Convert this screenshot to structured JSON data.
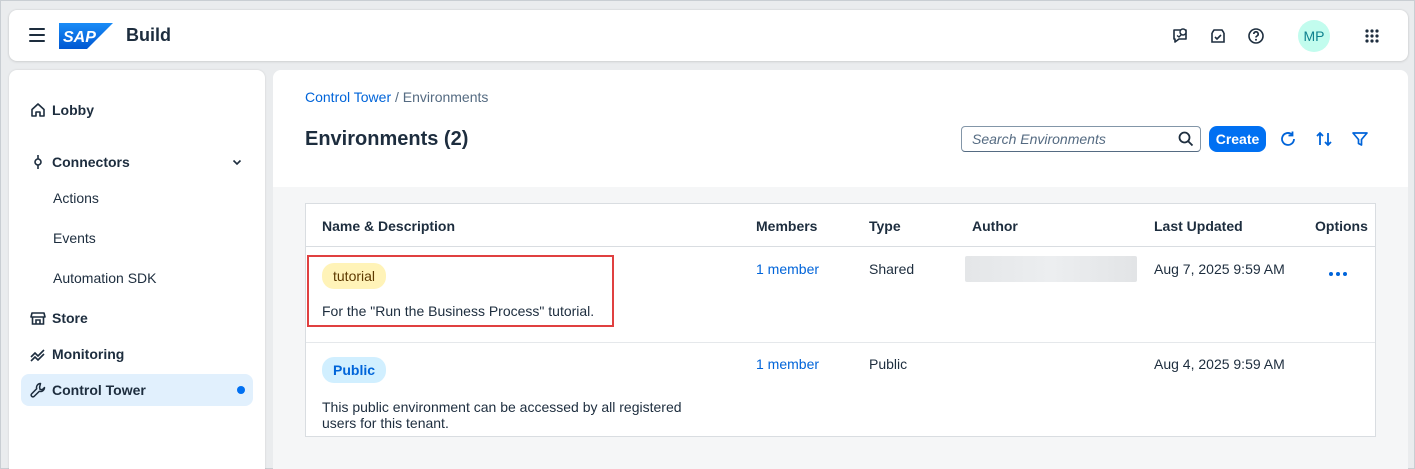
{
  "shell": {
    "logo_text": "SAP",
    "product": "Build",
    "avatar_initials": "MP",
    "icons": [
      "assistant-icon",
      "downloads-icon",
      "help-icon",
      "app-grid-icon"
    ],
    "colors": {
      "accent": "#0070f2",
      "logo": "#0070f2",
      "avatar_bg": "#c2fcee"
    }
  },
  "sidebar": {
    "lobby": "Lobby",
    "connectors": "Connectors",
    "actions": "Actions",
    "events": "Events",
    "automation_sdk": "Automation SDK",
    "store": "Store",
    "monitoring": "Monitoring",
    "control_tower": "Control Tower"
  },
  "page": {
    "breadcrumb_link": "Control Tower",
    "breadcrumb_sep": " / ",
    "breadcrumb_current": "Environments",
    "title": "Environments (2)",
    "search_placeholder": "Search Environments",
    "create_label": "Create"
  },
  "table": {
    "headers": {
      "name": "Name & Description",
      "members": "Members",
      "type": "Type",
      "author": "Author",
      "updated": "Last Updated",
      "options": "Options"
    },
    "rows": [
      {
        "tag": "tutorial",
        "description": "For the \"Run the Business Process\" tutorial.",
        "members": "1 member",
        "type": "Shared",
        "updated": "Aug 7, 2025 9:59 AM"
      },
      {
        "tag": "Public",
        "description": "This public environment can be accessed by all registered users for this tenant.",
        "members": "1 member",
        "type": "Public",
        "updated": "Aug 4, 2025 9:59 AM"
      }
    ]
  }
}
